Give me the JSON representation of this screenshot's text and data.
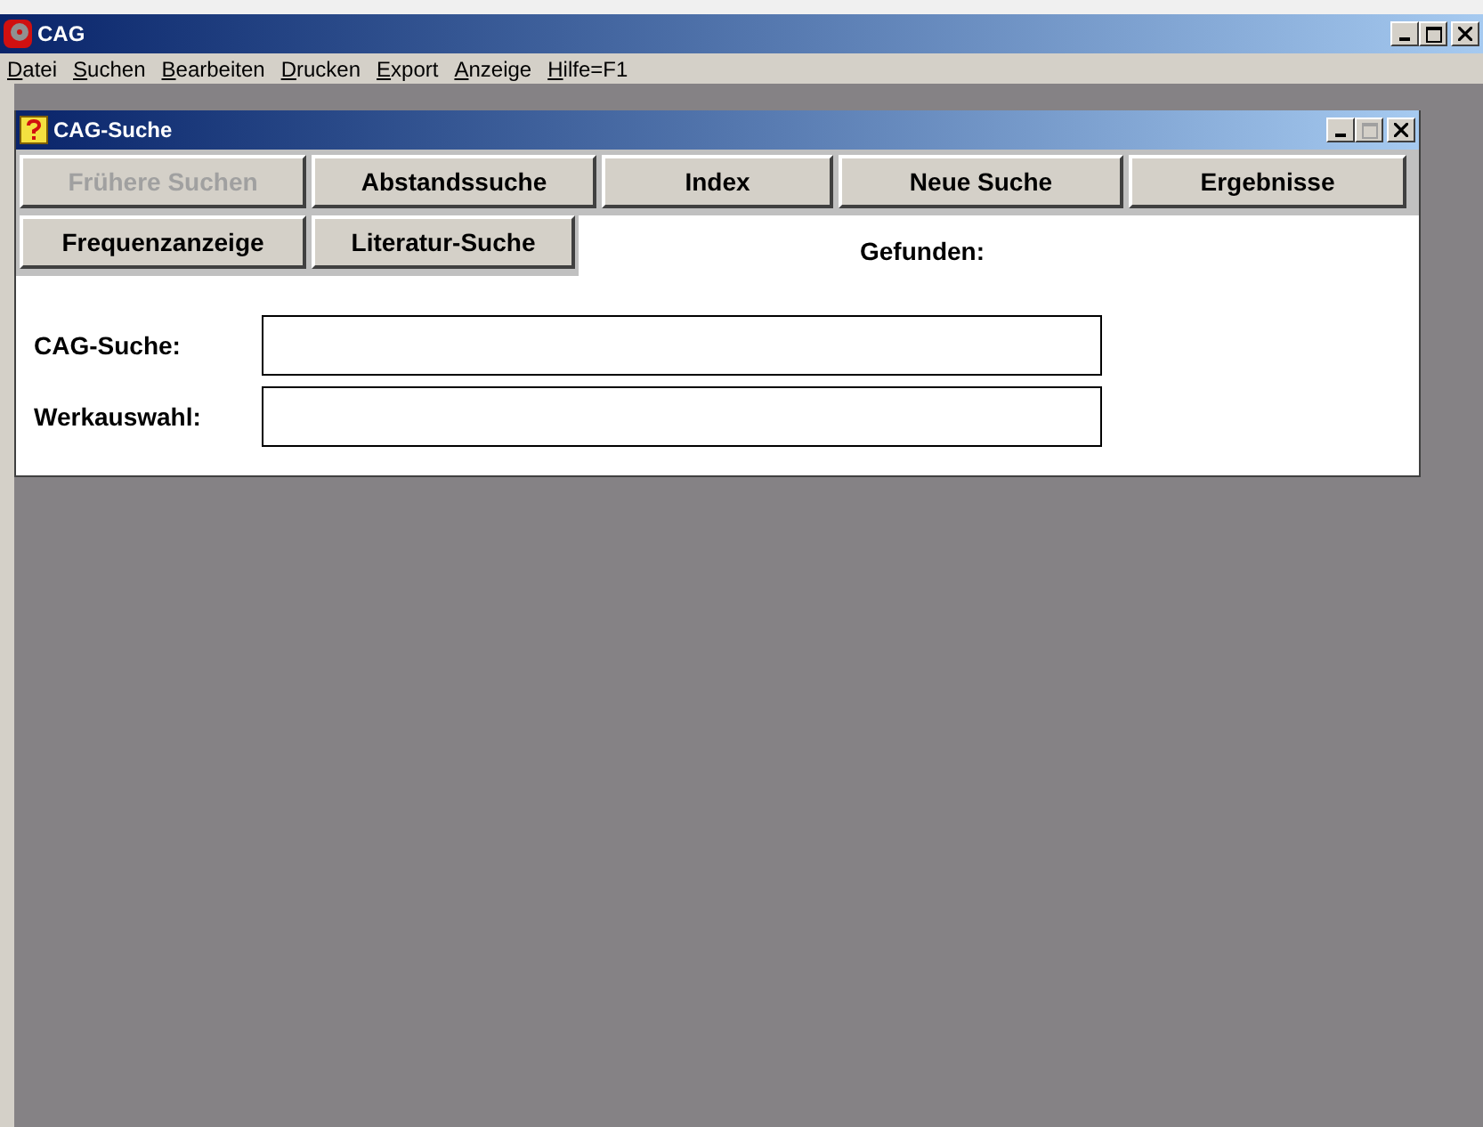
{
  "window": {
    "title": "CAG"
  },
  "menu": [
    {
      "label": "Datei"
    },
    {
      "label": "Suchen"
    },
    {
      "label": "Bearbeiten"
    },
    {
      "label": "Drucken"
    },
    {
      "label": "Export"
    },
    {
      "label": "Anzeige"
    },
    {
      "label": "Hilfe=F1"
    }
  ],
  "child_window": {
    "title": "CAG-Suche",
    "buttons_row_1": [
      {
        "label": "Frühere Suchen",
        "disabled": true
      },
      {
        "label": "Abstandssuche",
        "disabled": false
      },
      {
        "label": "Index",
        "disabled": false
      },
      {
        "label": "Neue Suche",
        "disabled": false
      },
      {
        "label": "Ergebnisse",
        "disabled": false
      }
    ],
    "buttons_row_2": [
      {
        "label": "Frequenzanzeige",
        "disabled": false
      },
      {
        "label": "Literatur-Suche",
        "disabled": false
      }
    ],
    "found_label": "Gefunden:",
    "fields": [
      {
        "label": "CAG-Suche:"
      },
      {
        "label": "Werkauswahl:"
      }
    ]
  }
}
